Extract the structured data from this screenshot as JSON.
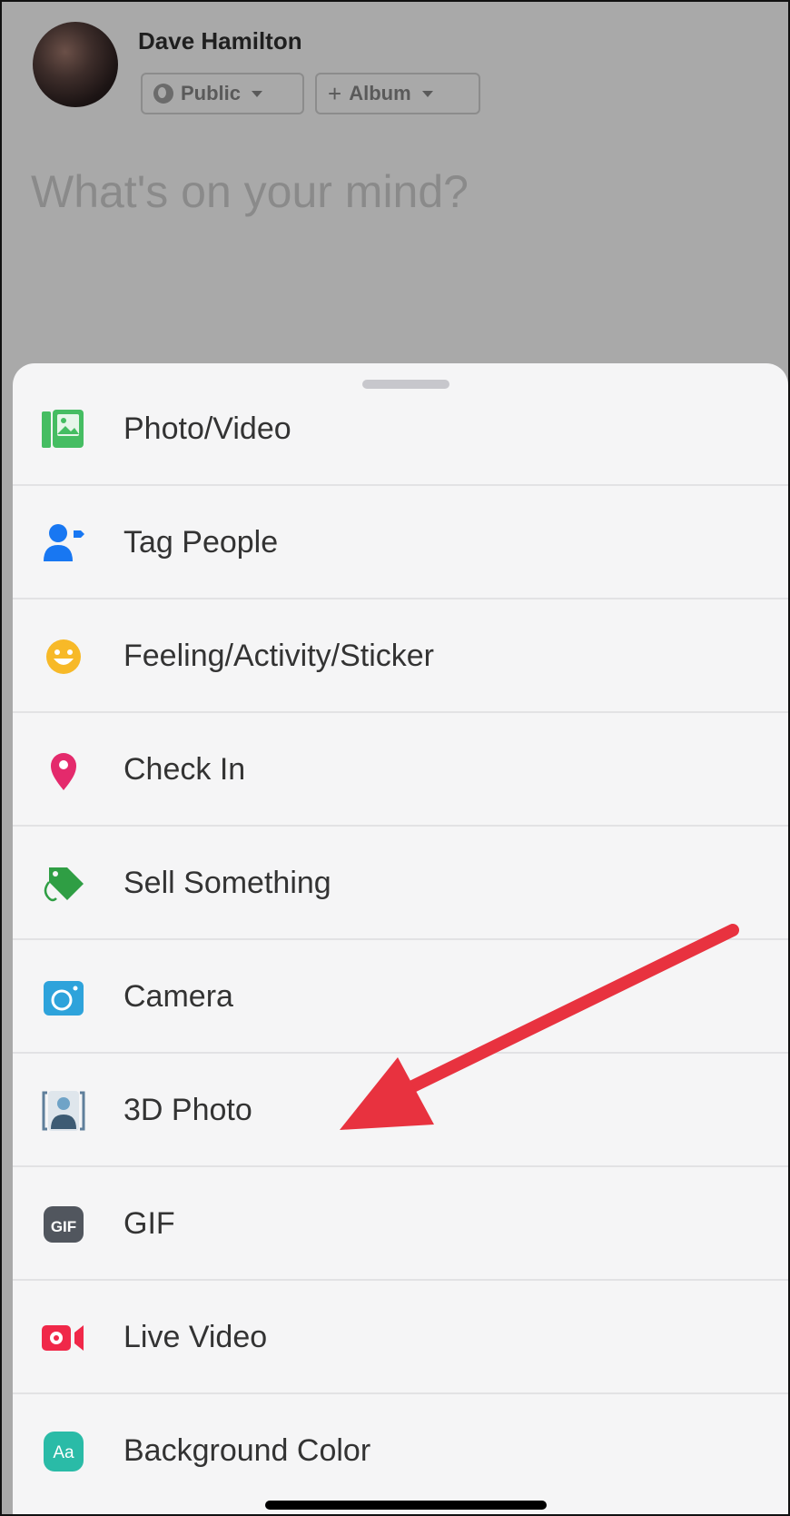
{
  "post": {
    "user_name": "Dave Hamilton",
    "audience_label": "Public",
    "album_label": "Album",
    "placeholder": "What's on your mind?"
  },
  "menu": {
    "items": [
      {
        "label": "Photo/Video",
        "icon": "photo-video-icon",
        "color": "#45bd62"
      },
      {
        "label": "Tag People",
        "icon": "tag-people-icon",
        "color": "#1877f2"
      },
      {
        "label": "Feeling/Activity/Sticker",
        "icon": "feeling-icon",
        "color": "#f7b928"
      },
      {
        "label": "Check In",
        "icon": "check-in-icon",
        "color": "#e42a6c"
      },
      {
        "label": "Sell Something",
        "icon": "sell-tag-icon",
        "color": "#2f9e44"
      },
      {
        "label": "Camera",
        "icon": "camera-icon",
        "color": "#2ea3db"
      },
      {
        "label": "3D Photo",
        "icon": "3d-photo-icon",
        "color": "#5f7f9b"
      },
      {
        "label": "GIF",
        "icon": "gif-icon",
        "color": "#51565e"
      },
      {
        "label": "Live Video",
        "icon": "live-video-icon",
        "color": "#f02849"
      },
      {
        "label": "Background Color",
        "icon": "background-color-icon",
        "color": "#2abba7"
      }
    ]
  },
  "annotation": {
    "arrow_color": "#e8323f"
  }
}
